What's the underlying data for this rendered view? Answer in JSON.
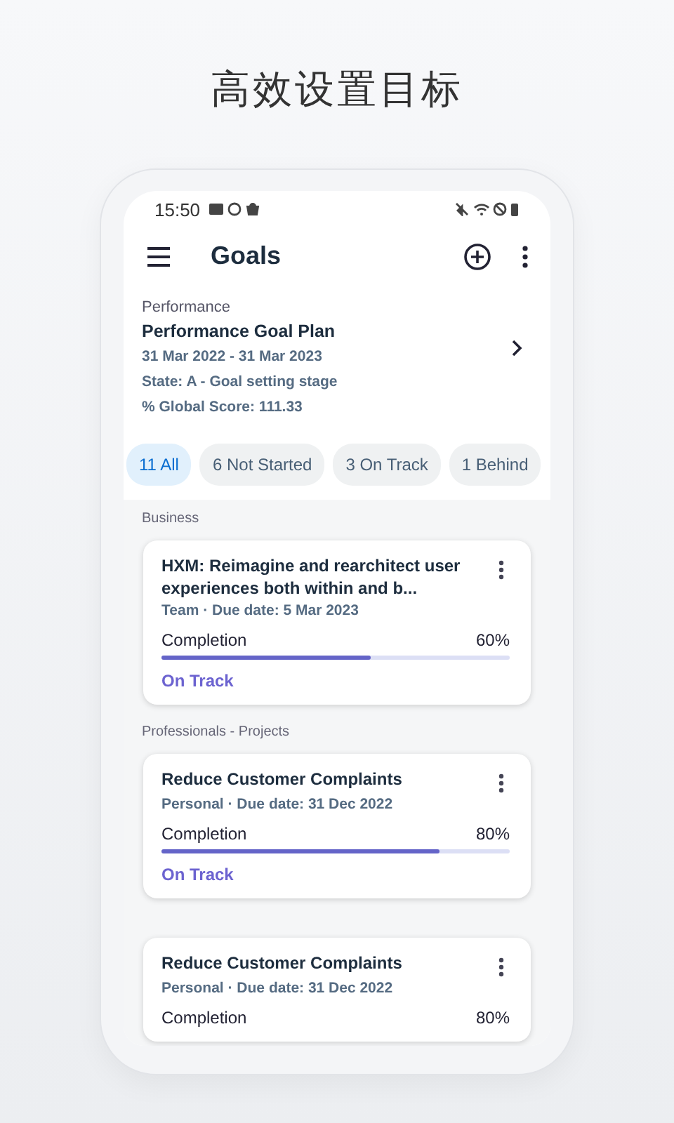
{
  "heading": "高效设置目标",
  "status_bar": {
    "time": "15:50"
  },
  "app_bar": {
    "title": "Goals"
  },
  "plan": {
    "category": "Performance",
    "title": "Performance Goal Plan",
    "dates": "31 Mar 2022 - 31 Mar 2023",
    "state": "State: A - Goal setting stage",
    "score": "% Global Score: 111.33"
  },
  "filters": [
    {
      "label": "11 All",
      "selected": true
    },
    {
      "label": "6 Not Started",
      "selected": false
    },
    {
      "label": "3 On Track",
      "selected": false
    },
    {
      "label": "1 Behind",
      "selected": false
    }
  ],
  "sections": [
    {
      "title": "Business",
      "goals": [
        {
          "title": "HXM: Reimagine and rearchitect user experiences both within and b...",
          "meta": "Team · Due date: 5 Mar 2023",
          "progress_label": "Completion",
          "percent": "60%",
          "level": 0.6,
          "status": "On Track"
        }
      ]
    },
    {
      "title": "Professionals - Projects",
      "goals": [
        {
          "title": "Reduce Customer Complaints",
          "meta": "Personal · Due date: 31 Dec 2022",
          "progress_label": "Completion",
          "percent": "80%",
          "level": 0.8,
          "status": "On Track"
        },
        {
          "title": "Reduce Customer Complaints",
          "meta": "Personal · Due date: 31 Dec 2022",
          "progress_label": "Completion",
          "percent": "80%"
        }
      ]
    }
  ]
}
